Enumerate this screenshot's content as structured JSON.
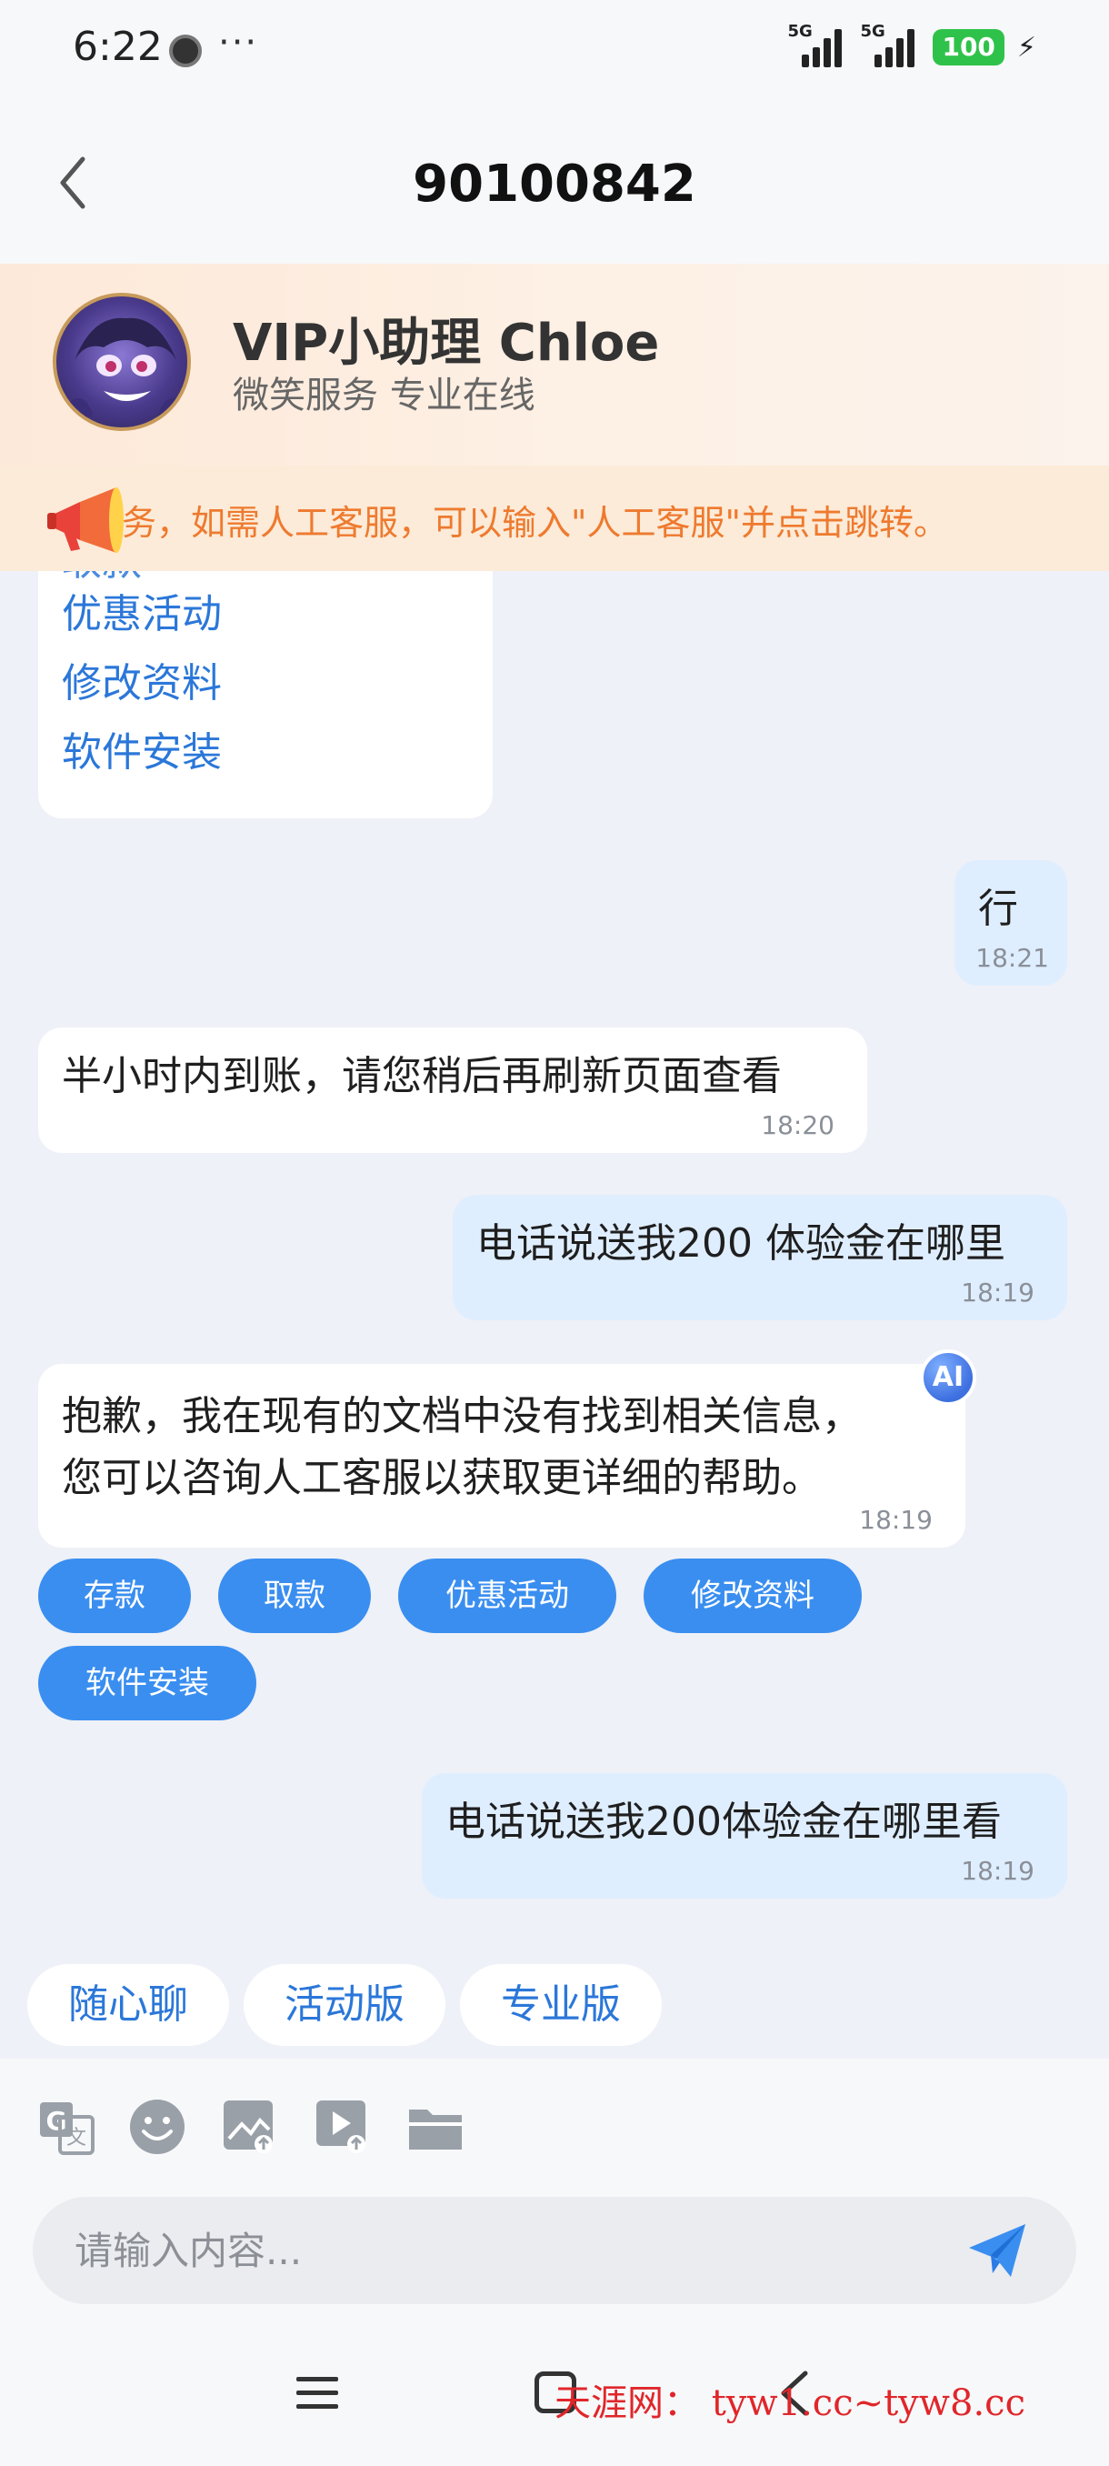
{
  "status_bar": {
    "time": "6:22",
    "more": "···",
    "signal_1_label": "5G",
    "signal_2_label": "5G",
    "battery": "100"
  },
  "header": {
    "title": "90100842"
  },
  "assistant": {
    "name": "VIP小助理 Chloe",
    "subtitle": "微笑服务 专业在线"
  },
  "notice": {
    "text": "务，如需人工客服，可以输入\"人工客服\"并点击跳转。"
  },
  "messages": {
    "menu_partial": "取款",
    "menu_items": [
      "优惠活动",
      "修改资料",
      "软件安装"
    ],
    "m1": {
      "text": "行",
      "time": "18:21"
    },
    "m2": {
      "text": "半小时内到账，请您稍后再刷新页面查看",
      "time": "18:20"
    },
    "m3": {
      "text": "电话说送我200 体验金在哪里",
      "time": "18:19"
    },
    "m4": {
      "line1": "抱歉，我在现有的文档中没有找到相关信息，",
      "line2": "您可以咨询人工客服以获取更详细的帮助。",
      "time": "18:19",
      "badge": "AI"
    },
    "m5": {
      "text": "电话说送我200体验金在哪里看",
      "time": "18:19"
    }
  },
  "quick_replies": [
    "存款",
    "取款",
    "优惠活动",
    "修改资料",
    "软件安装"
  ],
  "quick_tabs": [
    "随心聊",
    "活动版",
    "专业版"
  ],
  "toolbar_icons": [
    "translate-icon",
    "emoji-icon",
    "image-icon",
    "video-icon",
    "folder-icon"
  ],
  "input": {
    "placeholder": "请输入内容..."
  },
  "watermark": "天涯网： tyw1.cc~tyw8.cc",
  "colors": {
    "accent": "#3a8ef0",
    "link": "#2b77d9",
    "notice": "#ee7a2f",
    "right_bubble": "#dfeeff",
    "battery": "#2fc24a"
  }
}
